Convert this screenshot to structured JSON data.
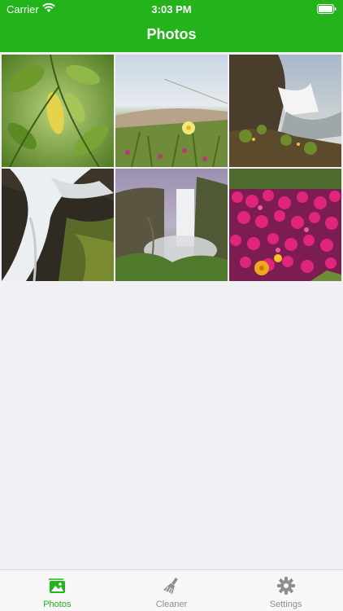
{
  "status_bar": {
    "carrier": "Carrier",
    "time": "3:03 PM"
  },
  "nav": {
    "title": "Photos"
  },
  "photos": [
    {
      "subject": "leaves"
    },
    {
      "subject": "beach-flower"
    },
    {
      "subject": "coast-waterfall"
    },
    {
      "subject": "waterfall-closeup"
    },
    {
      "subject": "tall-waterfall"
    },
    {
      "subject": "pink-flowers"
    }
  ],
  "tabs": [
    {
      "label": "Photos",
      "icon": "photos-icon",
      "active": true
    },
    {
      "label": "Cleaner",
      "icon": "broom-icon",
      "active": false
    },
    {
      "label": "Settings",
      "icon": "gear-icon",
      "active": false
    }
  ],
  "colors": {
    "accent": "#22b41a",
    "inactive": "#8e8e93",
    "background": "#f0f0f5"
  }
}
